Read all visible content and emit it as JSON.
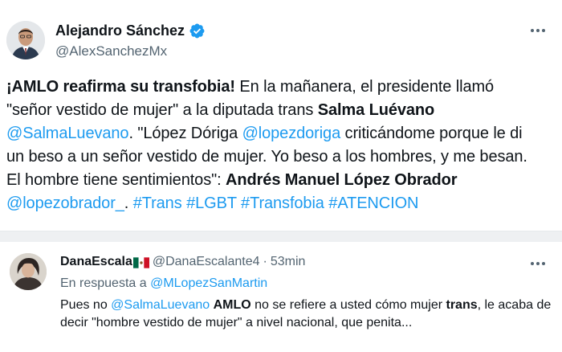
{
  "tweet1": {
    "author_name": "Alejandro Sánchez",
    "author_handle": "@AlexSanchezMx",
    "verified": true,
    "body": {
      "s1": "¡AMLO reafirma su transfobia!",
      "s2": " En la mañanera, el presidente llamó \"señor vestido de mujer\" a la diputada trans ",
      "s3": "Salma Luévano",
      "s4": "@SalmaLuevano",
      "s5": ". \"López Dóriga ",
      "s6": "@lopezdoriga",
      "s7": " criticándome porque le di un beso a un señor vestido de mujer. Yo beso a los hombres, y me besan. El hombre tiene sentimientos\": ",
      "s8": "Andrés Manuel López Obrador",
      "s9": "@lopezobrador_",
      "s10": ". ",
      "h1": "#Trans",
      "h2": "#LGBT",
      "h3": "#Transfobia",
      "h4": "#ATENCION"
    }
  },
  "tweet2": {
    "author_name": "DanaEscala",
    "author_handle": "@DanaEscalante4",
    "separator": "·",
    "time": "53min",
    "reply_prefix": "En respuesta a ",
    "reply_handle": "@MLopezSanMartin",
    "body": {
      "s1": "Pues no ",
      "s2": "@SalmaLuevano",
      "s3": " ",
      "s4": "AMLO",
      "s5": " no se refiere a usted cómo mujer ",
      "s6": "trans",
      "s7": ", le acaba de decir \"hombre vestido de mujer\" a nivel nacional, que penita..."
    }
  },
  "colors": {
    "link": "#1d9bf0",
    "secondary_text": "#536471",
    "primary_text": "#0f1419"
  },
  "icons": {
    "verified": "verified-badge-icon",
    "more": "more-options-icon",
    "flag": "mexico-flag-icon"
  }
}
